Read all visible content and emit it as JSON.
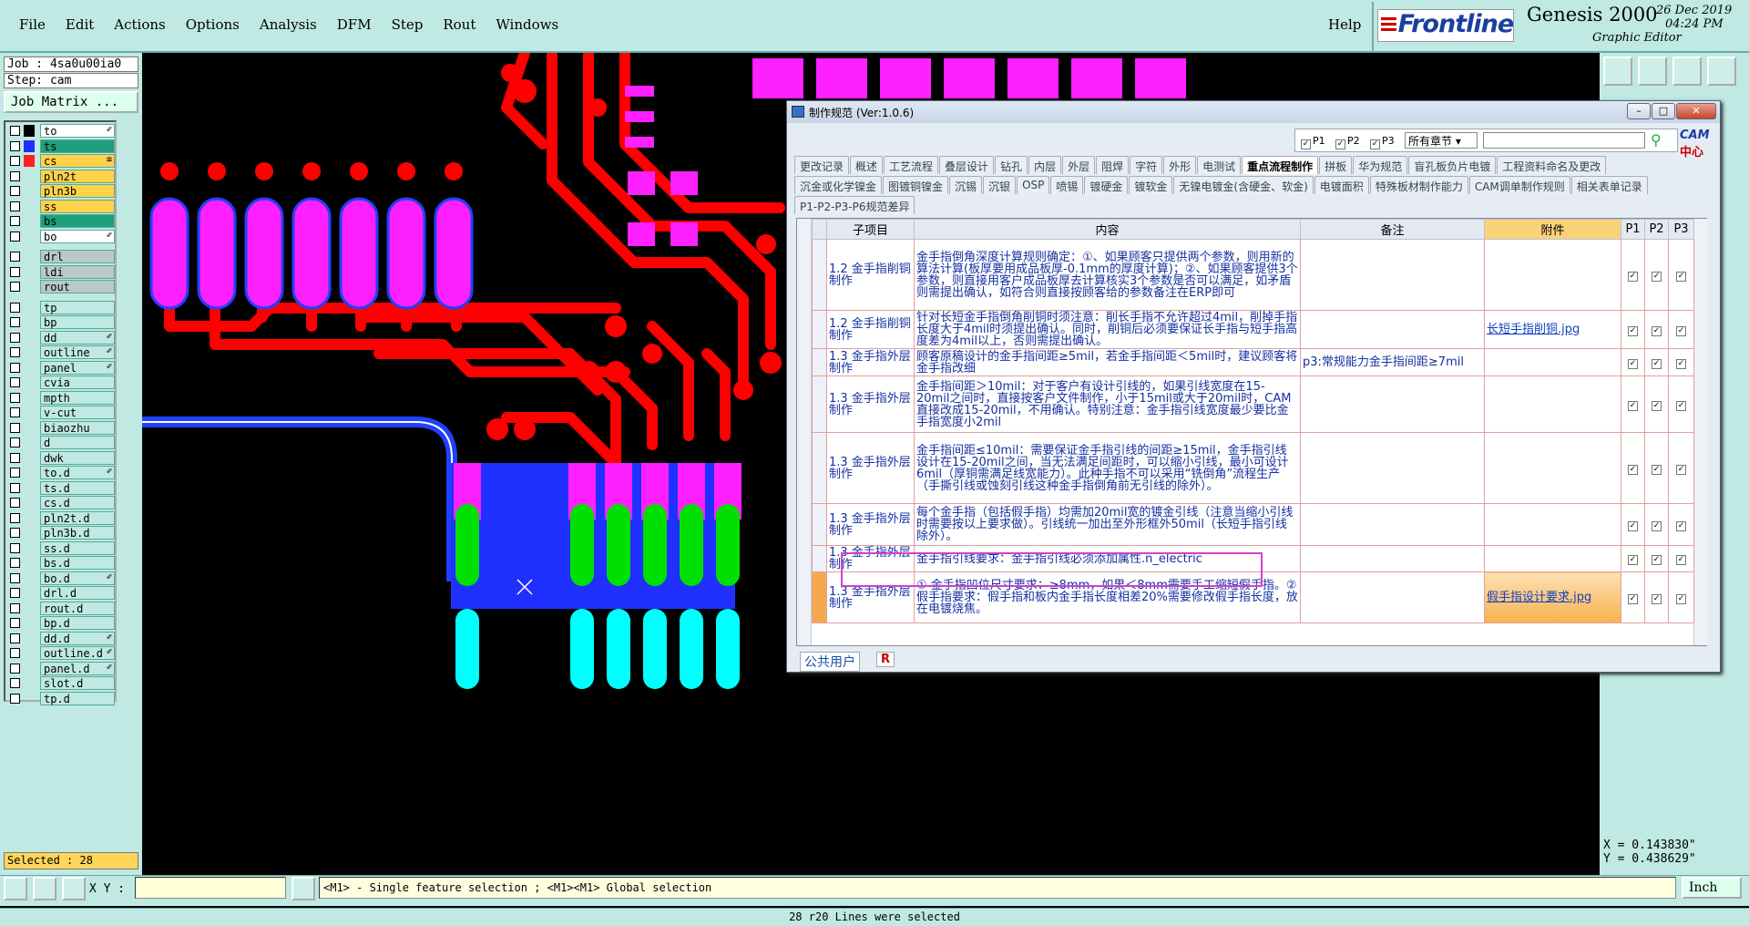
{
  "menubar": {
    "items": [
      "File",
      "Edit",
      "Actions",
      "Options",
      "Analysis",
      "DFM",
      "Step",
      "Rout",
      "Windows"
    ],
    "help": "Help"
  },
  "brand": {
    "logo": "Frontline",
    "title": "Genesis 2000",
    "subtitle": "Graphic Editor",
    "date": "26 Dec 2019",
    "time": "04:24 PM"
  },
  "left": {
    "job": "Job : 4sa0u00ia0",
    "step": "Step: cam",
    "job_matrix": "Job Matrix ...",
    "selected": "Selected : 28",
    "layers": [
      {
        "name": "to",
        "color": "#ffffff",
        "swatch": "#000000",
        "icon": "✐"
      },
      {
        "name": "ts",
        "color": "#1fa07a",
        "swatch": "#2030ff",
        "icon": ""
      },
      {
        "name": "cs",
        "color": "#ffd24a",
        "swatch": "#ff2020",
        "icon": "≡"
      },
      {
        "name": "pln2t",
        "color": "#ffd24a",
        "swatch": "",
        "icon": ""
      },
      {
        "name": "pln3b",
        "color": "#ffd24a",
        "swatch": "",
        "icon": ""
      },
      {
        "name": "ss",
        "color": "#ffd24a",
        "swatch": "",
        "icon": ""
      },
      {
        "name": "bs",
        "color": "#1fa07a",
        "swatch": "",
        "icon": ""
      },
      {
        "name": "bo",
        "color": "#ffffff",
        "swatch": "",
        "icon": "✐"
      },
      {
        "name": "drl",
        "color": "#b9c8c8",
        "swatch": "",
        "icon": ""
      },
      {
        "name": "ldi",
        "color": "#b9c8c8",
        "swatch": "",
        "icon": ""
      },
      {
        "name": "rout",
        "color": "#b9c8c8",
        "swatch": "",
        "icon": ""
      },
      {
        "name": "tp",
        "color": "#bfe9e2",
        "swatch": "",
        "icon": ""
      },
      {
        "name": "bp",
        "color": "#bfe9e2",
        "swatch": "",
        "icon": ""
      },
      {
        "name": "dd",
        "color": "#bfe9e2",
        "swatch": "",
        "icon": "✐"
      },
      {
        "name": "outline",
        "color": "#bfe9e2",
        "swatch": "",
        "icon": "✐"
      },
      {
        "name": "panel",
        "color": "#bfe9e2",
        "swatch": "",
        "icon": "✐"
      },
      {
        "name": "cvia",
        "color": "#bfe9e2",
        "swatch": "",
        "icon": ""
      },
      {
        "name": "mpth",
        "color": "#bfe9e2",
        "swatch": "",
        "icon": ""
      },
      {
        "name": "v-cut",
        "color": "#bfe9e2",
        "swatch": "",
        "icon": ""
      },
      {
        "name": "biaozhu",
        "color": "#bfe9e2",
        "swatch": "",
        "icon": ""
      },
      {
        "name": "d",
        "color": "#bfe9e2",
        "swatch": "",
        "icon": ""
      },
      {
        "name": "dwk",
        "color": "#bfe9e2",
        "swatch": "",
        "icon": ""
      },
      {
        "name": "to.d",
        "color": "#bfe9e2",
        "swatch": "",
        "icon": "✐"
      },
      {
        "name": "ts.d",
        "color": "#bfe9e2",
        "swatch": "",
        "icon": ""
      },
      {
        "name": "cs.d",
        "color": "#bfe9e2",
        "swatch": "",
        "icon": ""
      },
      {
        "name": "pln2t.d",
        "color": "#bfe9e2",
        "swatch": "",
        "icon": ""
      },
      {
        "name": "pln3b.d",
        "color": "#bfe9e2",
        "swatch": "",
        "icon": ""
      },
      {
        "name": "ss.d",
        "color": "#bfe9e2",
        "swatch": "",
        "icon": ""
      },
      {
        "name": "bs.d",
        "color": "#bfe9e2",
        "swatch": "",
        "icon": ""
      },
      {
        "name": "bo.d",
        "color": "#bfe9e2",
        "swatch": "",
        "icon": "✐"
      },
      {
        "name": "drl.d",
        "color": "#bfe9e2",
        "swatch": "",
        "icon": ""
      },
      {
        "name": "rout.d",
        "color": "#bfe9e2",
        "swatch": "",
        "icon": ""
      },
      {
        "name": "bp.d",
        "color": "#bfe9e2",
        "swatch": "",
        "icon": ""
      },
      {
        "name": "dd.d",
        "color": "#bfe9e2",
        "swatch": "",
        "icon": "✐"
      },
      {
        "name": "outline.d",
        "color": "#bfe9e2",
        "swatch": "",
        "icon": "✐"
      },
      {
        "name": "panel.d",
        "color": "#bfe9e2",
        "swatch": "",
        "icon": "✐"
      },
      {
        "name": "slot.d",
        "color": "#bfe9e2",
        "swatch": "",
        "icon": ""
      },
      {
        "name": "tp.d",
        "color": "#bfe9e2",
        "swatch": "",
        "icon": ""
      }
    ]
  },
  "right": {
    "x": "X = 0.143830\"",
    "y": "Y = 0.438629\""
  },
  "bottom": {
    "xy_label": "X Y :",
    "hint": "<M1> - Single feature selection ; <M1><M1> Global selection",
    "units": "Inch",
    "status": "28 r20 Lines were selected"
  },
  "dialog": {
    "title": "制作规范 (Ver:1.0.6)",
    "filters": [
      "P1",
      "P2",
      "P3"
    ],
    "chapter": "所有章节",
    "cam_logo": "CAM",
    "cam_logo2": "中心",
    "tabs_row1": [
      "更改记录",
      "概述",
      "工艺流程",
      "叠层设计",
      "钻孔",
      "内层",
      "外层",
      "阻焊",
      "字符",
      "外形",
      "电测试",
      "重点流程制作",
      "拼板",
      "华为规范",
      "盲孔板负片电镀",
      "工程资料命名及更改"
    ],
    "active_tab": "重点流程制作",
    "tabs_row2": [
      "沉金或化学镍金",
      "图镀铜镍金",
      "沉锡",
      "沉银",
      "OSP",
      "喷锡",
      "镀硬金",
      "镀软金",
      "无镍电镀金(含硬金、软金)",
      "电镀面积",
      "特殊板材制作能力",
      "CAM调单制作规则",
      "相关表单记录"
    ],
    "tabs_row3": [
      "P1-P2-P3-P6规范差异"
    ],
    "columns": {
      "sub": "子项目",
      "content": "内容",
      "note": "备注",
      "attach": "附件",
      "p1": "P1",
      "p2": "P2",
      "p3": "P3"
    },
    "rows": [
      {
        "sub": "1.2 金手指削铜制作",
        "content": "金手指倒角深度计算规则确定：①、如果顾客只提供两个参数，则用新的算法计算(板厚要用成品板厚-0.1mm的厚度计算)；②、如果顾客提供3个参数，则直接用客户成品板厚去计算核实3个参数是否可以满足，如矛盾则需提出确认，如符合则直接按顾客给的参数备注在ERP即可",
        "note": "",
        "attach": ""
      },
      {
        "sub": "1.2 金手指削铜制作",
        "content": "针对长短金手指倒角削铜时须注意：削长手指不允许超过4mil，削掉手指长度大于4mil时须提出确认。同时，削铜后必须要保证长手指与短手指高度差为4mil以上，否则需提出确认。",
        "note": "",
        "attach": "长短手指削铜.jpg"
      },
      {
        "sub": "1.3 金手指外层制作",
        "content": "顾客原稿设计的金手指间距≥5mil，若金手指间距＜5mil时，建议顾客将金手指改细",
        "note": "p3:常规能力金手指间距≥7mil",
        "attach": ""
      },
      {
        "sub": "1.3 金手指外层制作",
        "content": "金手指间距＞10mil：对于客户有设计引线的，如果引线宽度在15-20mil之间时，直接按客户文件制作，小于15mil或大于20mil时，CAM直接改成15-20mil，不用确认。特别注意：金手指引线宽度最少要比金手指宽度小2mil",
        "note": "",
        "attach": ""
      },
      {
        "sub": "1.3 金手指外层制作",
        "content": "金手指间距≤10mil：需要保证金手指引线的间距≥15mil，金手指引线设计在15-20mil之间，当无法满足间距时，可以缩小引线，最小可设计6mil（厚铜需满足线宽能力）。此种手指不可以采用“铣倒角”流程生产（手撕引线或蚀刻引线这种金手指倒角前无引线的除外）。",
        "note": "",
        "attach": ""
      },
      {
        "sub": "1.3 金手指外层制作",
        "content": "每个金手指（包括假手指）均需加20mil宽的镀金引线（注意当缩小引线时需要按以上要求做）。引线统一加出至外形框外50mil（长短手指引线除外）。",
        "note": "",
        "attach": ""
      },
      {
        "sub": "1.3 金手指外层制作",
        "content": "金手指引线要求：金手指引线必须添加属性.n_electric",
        "note": "",
        "attach": ""
      },
      {
        "sub": "1.3 金手指外层制作",
        "content": "① 金手指凹位尺寸要求：≥8mm，如果＜8mm需要手工缩短假手指。② 假手指要求：假手指和板内金手指长度相差20%需要修改假手指长度，放在电镀烧焦。",
        "note": "",
        "attach": "假手指设计要求.jpg"
      }
    ],
    "footer_user": "公共用户",
    "footer_r": "R"
  }
}
